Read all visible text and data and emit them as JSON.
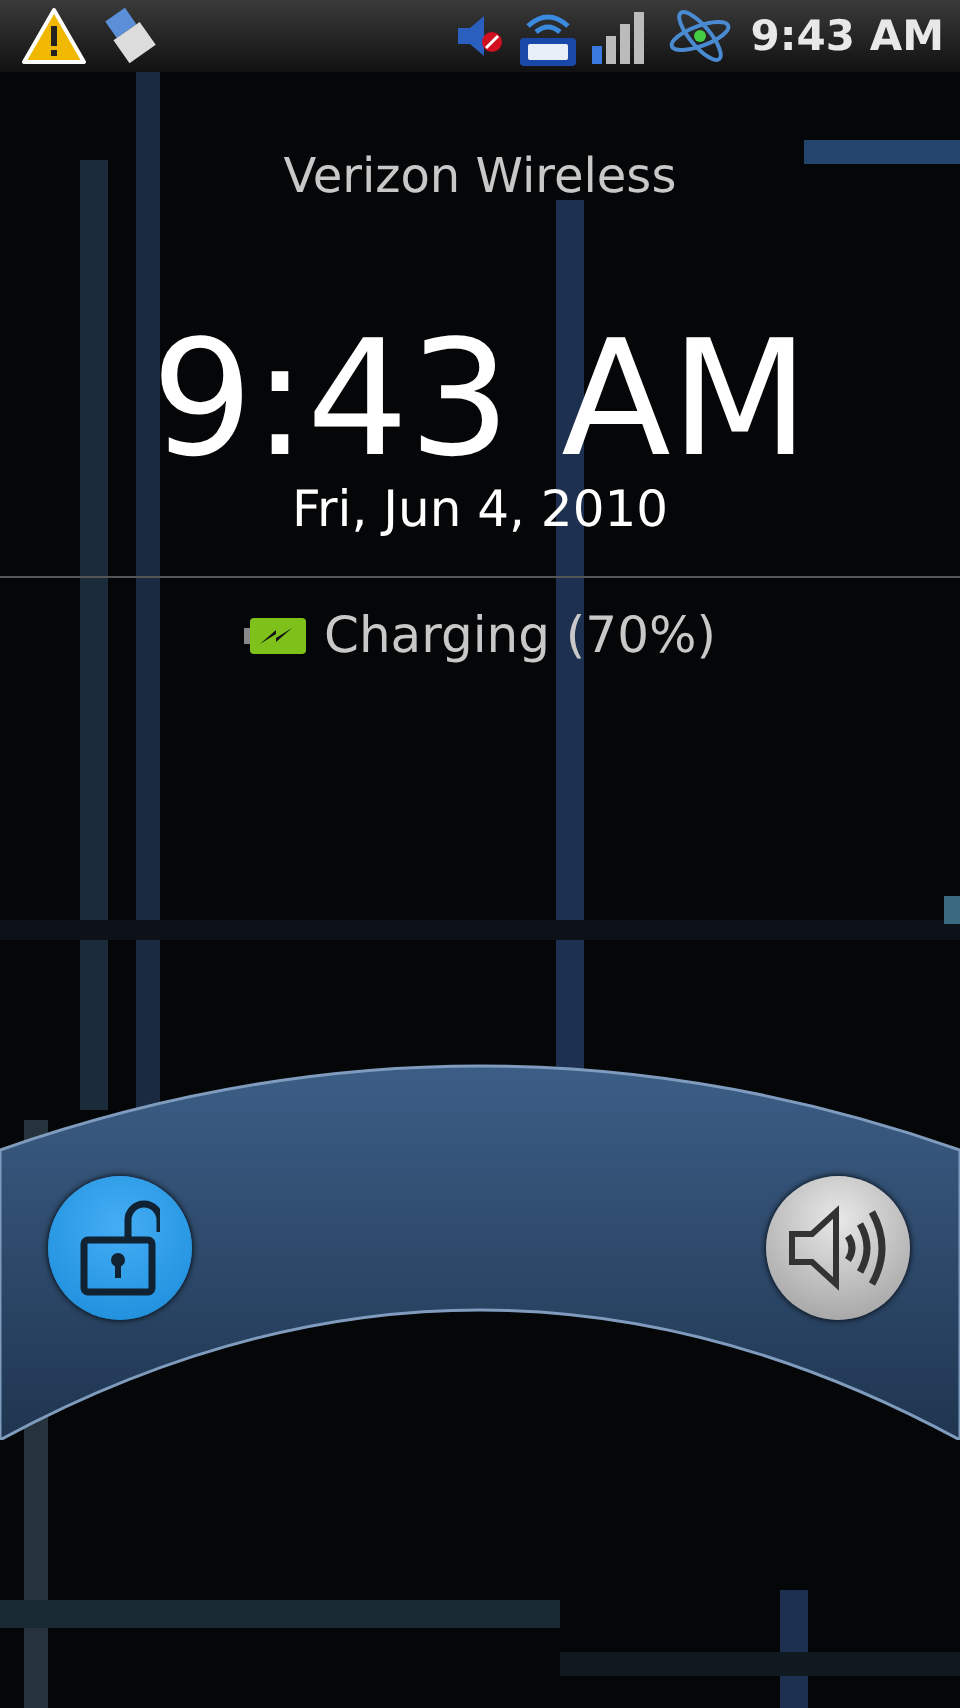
{
  "status_bar": {
    "time": "9:43 AM"
  },
  "carrier": "Verizon Wireless",
  "clock": {
    "time": "9:43 AM",
    "date": "Fri, Jun 4, 2010"
  },
  "charging": {
    "text": "Charging (70%)"
  },
  "controls": [
    {
      "kind": "unlock"
    },
    {
      "kind": "sound"
    }
  ]
}
